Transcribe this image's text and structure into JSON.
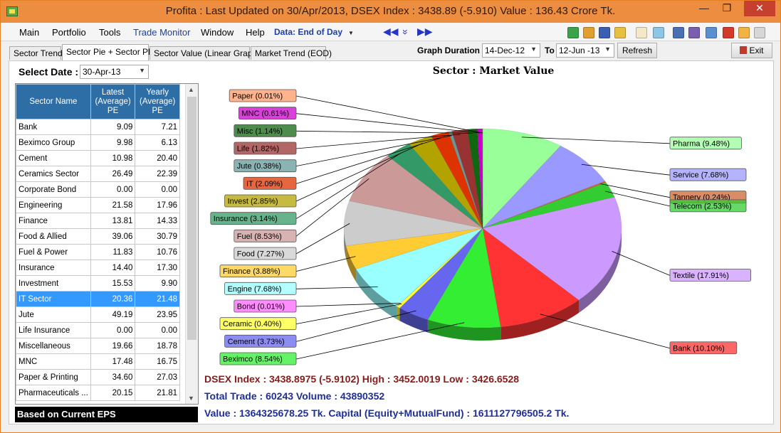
{
  "window": {
    "title": "Profita : Last Updated on 30/Apr/2013,  DSEX Index : 3438.89 (-5.910)  Value : 136.43 Crore Tk.",
    "minimize": "—",
    "restore": "❐",
    "close": "✕"
  },
  "menu": {
    "items": [
      "Main",
      "Portfolio",
      "Tools",
      "Trade Monitor",
      "Window",
      "Help"
    ],
    "data_combo": "Data: End of Day"
  },
  "nav": {
    "first": "◀◀",
    "down": "»",
    "last": "▶▶"
  },
  "tabs": [
    "Sector Trend",
    "Sector Pie + Sector PE",
    "Sector Value (Linear Graph)",
    "Market Trend (EOD)"
  ],
  "graph_duration": {
    "label": "Graph Duration :",
    "from": "14-Dec-12",
    "to_label": "To",
    "to": "12-Jun -13",
    "refresh": "Refresh",
    "exit": "Exit"
  },
  "select_date": {
    "label": "Select Date :",
    "value": "30-Apr-13"
  },
  "grid": {
    "headers": [
      "Sector Name",
      "Latest (Average) PE",
      "Yearly (Average) PE"
    ],
    "rows": [
      [
        "Bank",
        "9.09",
        "7.21"
      ],
      [
        "Beximco Group",
        "9.98",
        "6.13"
      ],
      [
        "Cement",
        "10.98",
        "20.40"
      ],
      [
        "Ceramics Sector",
        "26.49",
        "22.39"
      ],
      [
        "Corporate Bond",
        "0.00",
        "0.00"
      ],
      [
        "Engineering",
        "21.58",
        "17.96"
      ],
      [
        "Finance",
        "13.81",
        "14.33"
      ],
      [
        "Food & Allied",
        "39.06",
        "30.79"
      ],
      [
        "Fuel & Power",
        "11.83",
        "10.76"
      ],
      [
        "Insurance",
        "14.40",
        "17.30"
      ],
      [
        "Investment",
        "15.53",
        "9.90"
      ],
      [
        "IT Sector",
        "20.36",
        "21.48"
      ],
      [
        "Jute",
        "49.19",
        "23.95"
      ],
      [
        "Life Insurance",
        "0.00",
        "0.00"
      ],
      [
        "Miscellaneous",
        "19.66",
        "18.78"
      ],
      [
        "MNC",
        "17.48",
        "16.75"
      ],
      [
        "Paper & Printing",
        "34.60",
        "27.03"
      ],
      [
        "Pharmaceuticals ...",
        "20.15",
        "21.81"
      ]
    ],
    "selected_row": "IT Sector"
  },
  "footer_label": "Based on Current EPS",
  "chart_data": {
    "type": "pie",
    "title": "Sector : Market Value",
    "slices": [
      {
        "label": "Pharma (9.48%)",
        "value": 9.48,
        "color": "#99ff99"
      },
      {
        "label": "Service (7.68%)",
        "value": 7.68,
        "color": "#9999ff"
      },
      {
        "label": "Tannery (0.24%)",
        "value": 0.24,
        "color": "#cc6633"
      },
      {
        "label": "Telecom (2.53%)",
        "value": 2.53,
        "color": "#33cc33"
      },
      {
        "label": "Textile (17.91%)",
        "value": 17.91,
        "color": "#cc99ff"
      },
      {
        "label": "Bank (10.10%)",
        "value": 10.1,
        "color": "#ff3333"
      },
      {
        "label": "Beximco (8.54%)",
        "value": 8.54,
        "color": "#33ee33"
      },
      {
        "label": "Cement (3.73%)",
        "value": 3.73,
        "color": "#6666ee"
      },
      {
        "label": "Ceramic (0.40%)",
        "value": 0.4,
        "color": "#ffff33"
      },
      {
        "label": "Bond (0.01%)",
        "value": 0.01,
        "color": "#ff66ff"
      },
      {
        "label": "Engine (7.68%)",
        "value": 7.68,
        "color": "#99ffff"
      },
      {
        "label": "Finance (3.88%)",
        "value": 3.88,
        "color": "#ffcc33"
      },
      {
        "label": "Food (7.27%)",
        "value": 7.27,
        "color": "#cccccc"
      },
      {
        "label": "Fuel (8.53%)",
        "value": 8.53,
        "color": "#cc9999"
      },
      {
        "label": "Insurance (3.14%)",
        "value": 3.14,
        "color": "#339966"
      },
      {
        "label": "Invest (2.85%)",
        "value": 2.85,
        "color": "#b3a300"
      },
      {
        "label": "IT (2.09%)",
        "value": 2.09,
        "color": "#dd3300"
      },
      {
        "label": "Jute (0.38%)",
        "value": 0.38,
        "color": "#669999"
      },
      {
        "label": "Life (1.82%)",
        "value": 1.82,
        "color": "#993333"
      },
      {
        "label": "Misc (1.14%)",
        "value": 1.14,
        "color": "#116611"
      },
      {
        "label": "MNC (0.61%)",
        "value": 0.61,
        "color": "#cc00cc"
      },
      {
        "label": "Paper (0.01%)",
        "value": 0.01,
        "color": "#ff9966"
      }
    ]
  },
  "stats": {
    "line1": "DSEX Index : 3438.8975 (-5.9102)   High : 3452.0019   Low : 3426.6528",
    "line2": "Total Trade : 60243    Volume : 43890352",
    "line3": "Value : 1364325678.25 Tk.    Capital (Equity+MutualFund) : 1611127796505.2 Tk."
  }
}
